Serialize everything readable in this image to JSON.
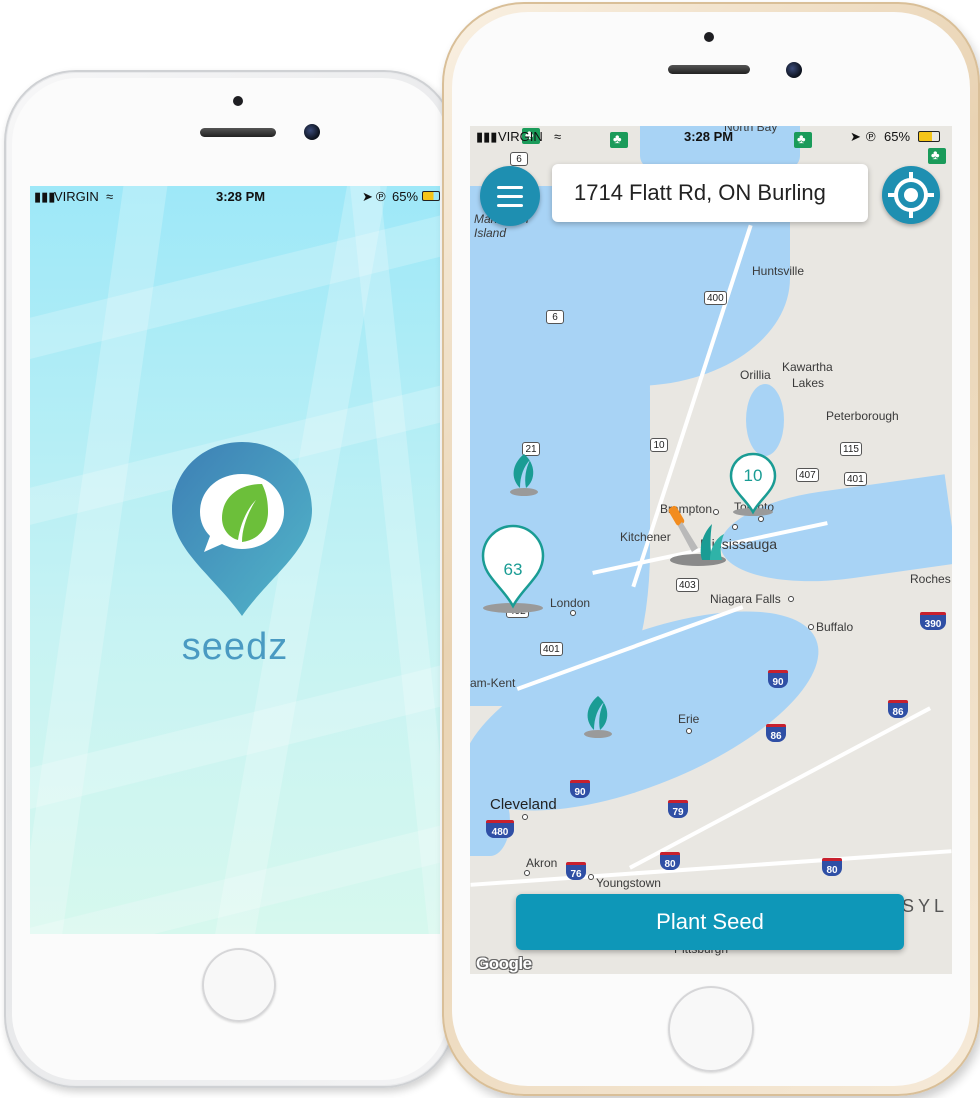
{
  "left_phone": {
    "status": {
      "carrier": "VIRGIN",
      "time": "3:28 PM",
      "battery": "65%"
    },
    "brand": {
      "name": "seedz",
      "color": "#4a9ac2"
    }
  },
  "right_phone": {
    "status": {
      "carrier": "VIRGIN",
      "time": "3:28 PM",
      "battery": "65%"
    },
    "search": {
      "value": "1714 Flatt Rd, ON Burling"
    },
    "plant_button": "Plant Seed",
    "accent": "#0e97b8",
    "map": {
      "attribution": "Google",
      "places": {
        "north_bay": "North Bay",
        "manitoulin": "Manitoulin",
        "island": "Island",
        "huntsville": "Huntsville",
        "orillia": "Orillia",
        "kawartha": "Kawartha",
        "lakes": "Lakes",
        "peterborough": "Peterborough",
        "brampton": "Brampton",
        "toronto": "Toronto",
        "kitchener": "Kitchener",
        "mississauga": "Mississauga",
        "london": "London",
        "niagara": "Niagara Falls",
        "buffalo": "Buffalo",
        "rochester": "Roches",
        "chatham": "am-Kent",
        "erie": "Erie",
        "cleveland": "Cleveland",
        "akron": "Akron",
        "youngstown": "Youngstown",
        "pittsburgh": "Pittsburgh",
        "penn": "SYL"
      },
      "highways": {
        "h6a": "6",
        "h6b": "6",
        "h400": "400",
        "h21": "21",
        "h10": "10",
        "h115": "115",
        "h407": "407",
        "h401a": "401",
        "h403": "403",
        "h402": "402",
        "h401b": "401"
      },
      "interstates": {
        "i390": "390",
        "i90a": "90",
        "i86a": "86",
        "i86b": "86",
        "i90b": "90",
        "i79": "79",
        "i480": "480",
        "i80a": "80",
        "i76": "76",
        "i80b": "80"
      },
      "clusters": {
        "toronto_count": "10",
        "london_count": "63"
      }
    }
  }
}
